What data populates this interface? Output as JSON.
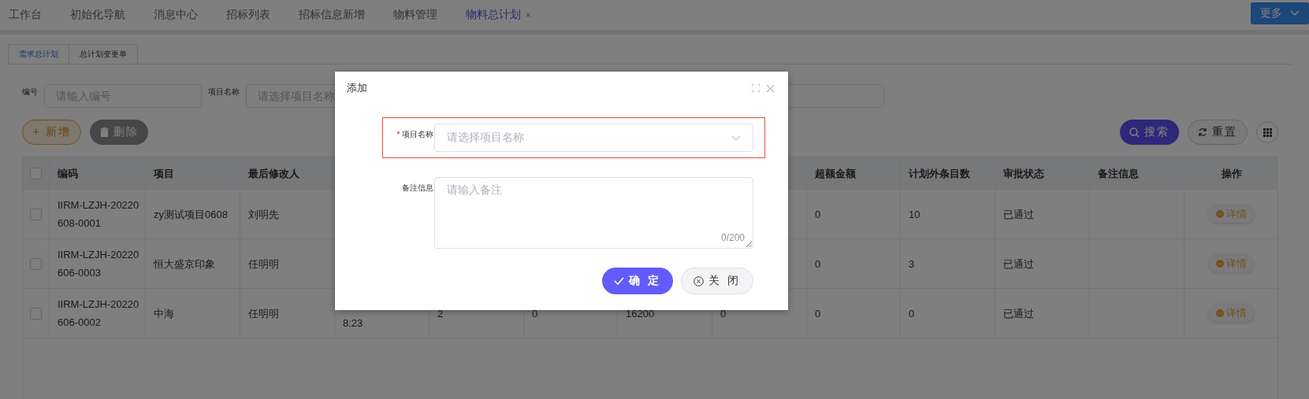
{
  "nav_tabs": [
    {
      "label": "工作台",
      "selected": false
    },
    {
      "label": "初始化导航",
      "selected": false
    },
    {
      "label": "消息中心",
      "selected": false
    },
    {
      "label": "招标列表",
      "selected": false
    },
    {
      "label": "招标信息新增",
      "selected": false
    },
    {
      "label": "物料管理",
      "selected": false
    },
    {
      "label": "物料总计划",
      "selected": true,
      "close": "×"
    }
  ],
  "more_button": "更多",
  "sub_tabs": [
    {
      "label": "需求总计划",
      "selected": true
    },
    {
      "label": "总计划变更单",
      "selected": false
    }
  ],
  "filters": [
    {
      "label": "编号",
      "placeholder": "请输入编号"
    },
    {
      "label": "项目名称",
      "placeholder": "请选择项目名称"
    }
  ],
  "toolbar": {
    "add": "+ 新增",
    "delete": "删除",
    "search": "搜索",
    "reset": "重置"
  },
  "table": {
    "header_checked": false,
    "columns": [
      "编码",
      "项目",
      "最后修改人",
      "超额金额",
      "计划外条目数",
      "审批状态",
      "备注信息",
      "操作"
    ],
    "rows": [
      {
        "selected": false,
        "code": "IIRM-LZJH-20220608-0001",
        "project": "zy测试项目0608",
        "modifier": "刘明先",
        "over_amount": "0",
        "unplanned_count": "10",
        "status": "已通过",
        "action": "详情"
      },
      {
        "selected": false,
        "code": "IIRM-LZJH-20220606-0003",
        "project": "恒大盛京印象",
        "modifier": "任明明",
        "over_amount": "0",
        "unplanned_count": "3",
        "status": "已通过",
        "action": "详情"
      },
      {
        "selected": false,
        "code": "IIRM-LZJH-20220606-0002",
        "project": "中海",
        "modifier": "任明明",
        "column_4": "8:23",
        "column_5": "2",
        "column_6": "0",
        "column_7": "16200",
        "column_8": "0",
        "over_amount": "0",
        "unplanned_count": "0",
        "status": "已通过",
        "action": "详情"
      }
    ]
  },
  "dialog": {
    "title": "添加",
    "fields": [
      {
        "kind": "select",
        "label": "项目名称",
        "required": true,
        "error": true,
        "placeholder": "请选择项目名称"
      },
      {
        "kind": "textarea",
        "label": "备注信息",
        "required": false,
        "error": false,
        "placeholder": "请输入备注",
        "counter": "0/200"
      }
    ],
    "confirm": "确 定",
    "close": "关 闭"
  }
}
